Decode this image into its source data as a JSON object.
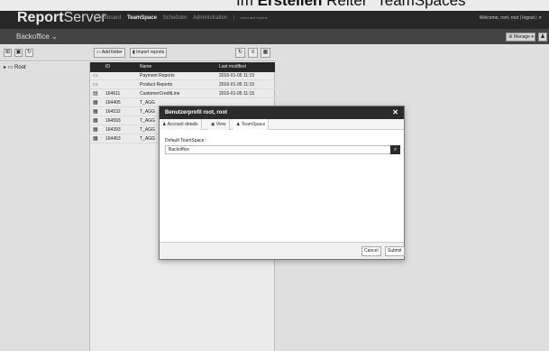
{
  "caption": {
    "prefix": "Im ",
    "bold": "Erstellen",
    "suffix": " Reiter \"TeamSpaces\""
  },
  "header": {
    "logo_bold": "Report",
    "logo_rest": "Server",
    "nav": [
      "Dashboard",
      "TeamSpace",
      "Scheduler",
      "Administration"
    ],
    "nav_extra": "executed reports",
    "welcome": "Welcome, root, root | logout |",
    "search_icon": "search-icon"
  },
  "subbar": {
    "breadcrumb": "Backoffice ⌄",
    "manage_label": "Manage"
  },
  "tree": {
    "root_label": "Root"
  },
  "list_toolbar": {
    "add_folder": "Add folder",
    "import_reports": "Import reports"
  },
  "table": {
    "columns": [
      "ID",
      "Name",
      "Last modified"
    ],
    "rows": [
      {
        "icon": "folder-icon",
        "id": "",
        "name": "Payment Reports",
        "date": "2016-01-05 11:15"
      },
      {
        "icon": "folder-icon",
        "id": "",
        "name": "Product Reports",
        "date": "2016-01-05 11:15"
      },
      {
        "icon": "report-icon",
        "id": "164611",
        "name": "CustomerCreditLine",
        "date": "2016-01-05 11:15"
      },
      {
        "icon": "table-icon",
        "id": "164405",
        "name": "T_AGG",
        "date": ""
      },
      {
        "icon": "table-icon",
        "id": "164532",
        "name": "T_AGG",
        "date": ""
      },
      {
        "icon": "table-icon",
        "id": "164593",
        "name": "T_AGG",
        "date": ""
      },
      {
        "icon": "table-icon",
        "id": "164393",
        "name": "T_AGG",
        "date": ""
      },
      {
        "icon": "table-icon",
        "id": "164453",
        "name": "T_AGG",
        "date": ""
      }
    ]
  },
  "dialog": {
    "title": "Benutzerprofil root, root",
    "tabs": [
      "Account details",
      "View",
      "TeamSpace"
    ],
    "field_label": "Default TeamSpace :",
    "field_value": "Backoffice",
    "cancel": "Cancel",
    "submit": "Submit"
  }
}
